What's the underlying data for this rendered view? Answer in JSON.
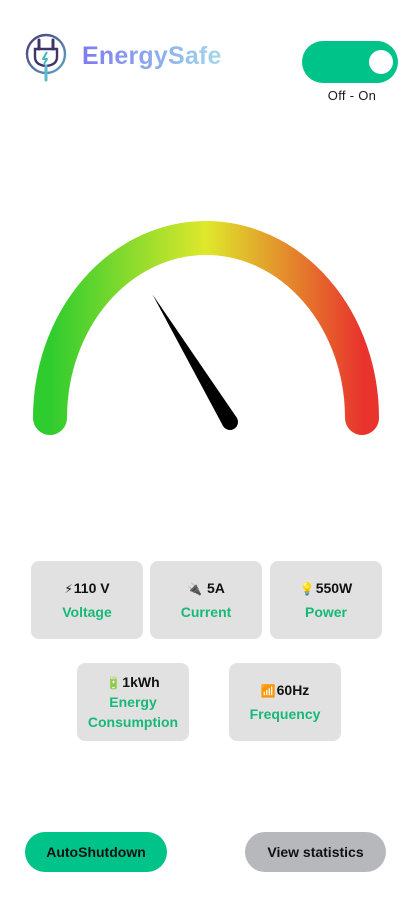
{
  "header": {
    "brand": "EnergySafe",
    "toggle": {
      "state": "on",
      "caption": "Off  -  On",
      "color": "#00c389"
    }
  },
  "gauge": {
    "level": 0.33,
    "colors": [
      "#2fcc2f",
      "#dfe82b",
      "#e8342d"
    ]
  },
  "metrics": [
    {
      "icon": "lightning-icon",
      "glyph": "⚡",
      "value": "110 V",
      "label": "Voltage"
    },
    {
      "icon": "plug-icon",
      "glyph": "🔌",
      "value": "5A",
      "label": "Current"
    },
    {
      "icon": "lightbulb-icon",
      "glyph": "💡",
      "value": "550W",
      "label": "Power"
    },
    {
      "icon": "battery-icon",
      "glyph": "🔋",
      "value": "1kWh",
      "label_line1": "Energy",
      "label_line2": "Consumption"
    },
    {
      "icon": "signal-bars-icon",
      "glyph": "📶",
      "value": "60Hz",
      "label": "Frequency"
    }
  ],
  "actions": {
    "auto_shutdown": "AutoShutdown",
    "view_statistics": "View statistics"
  }
}
